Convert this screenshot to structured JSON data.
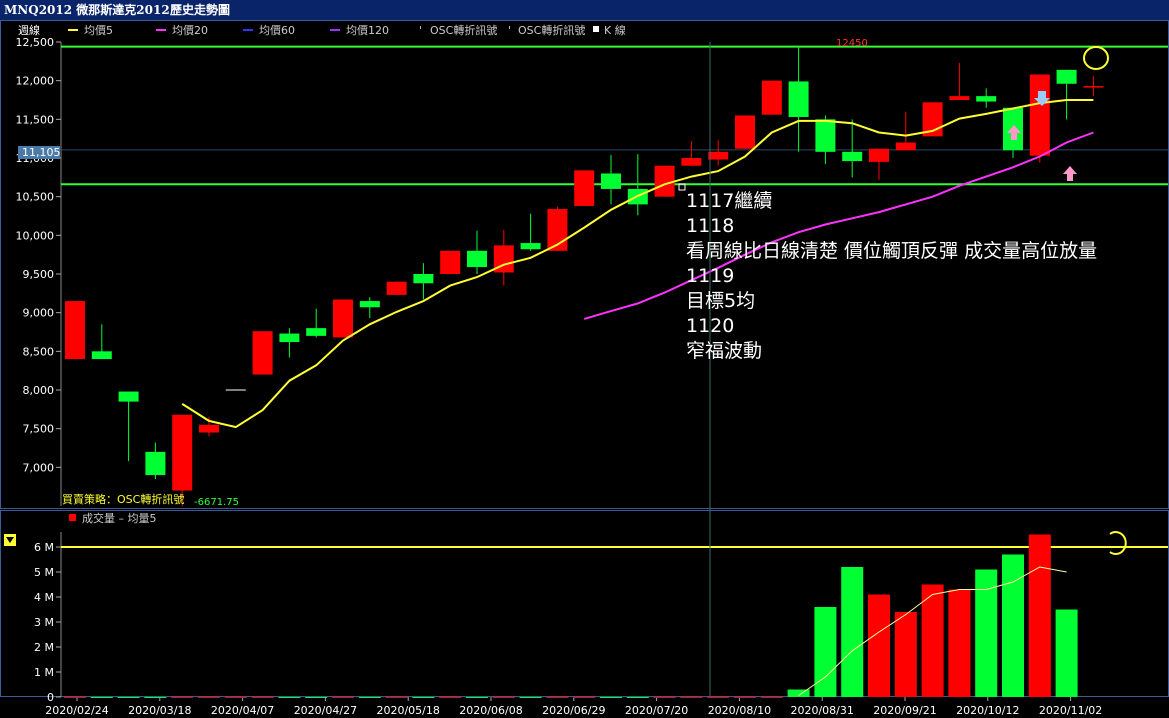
{
  "window": {
    "title": "MNQ2012 微那斯達克2012",
    "subtitle": "歷史走勢圖"
  },
  "legend": {
    "period": "週線",
    "ma5": "均價5",
    "ma20": "均價20",
    "ma60": "均價60",
    "ma120": "均價120",
    "osc1": "OSC轉折訊號",
    "osc2": "OSC轉折訊號",
    "kline": "K 線"
  },
  "strategy": {
    "label": "買賣策略：OSC轉折訊號",
    "value": "-6671.75"
  },
  "current_price_tag": "11,105",
  "max_label": "12450",
  "volume_legend": {
    "volume": "成交量",
    "ma": "均量5"
  },
  "annotation": [
    "1117繼續",
    "1118",
    "看周線比日線清楚  價位觸頂反彈 成交量高位放量",
    "1119",
    "目標5均",
    "1120",
    "窄福波動"
  ],
  "colors": {
    "up": "#ff0000",
    "down": "#00ff33",
    "ma5": "#ffff33",
    "ma20": "#ff33ff",
    "ma60": "#3333ff",
    "ma120": "#9933ff",
    "hline": "#33ff33"
  },
  "chart_data": {
    "type": "candlestick",
    "x_labels": [
      "2020/02/24",
      "2020/03/18",
      "2020/04/07",
      "2020/04/27",
      "2020/05/18",
      "2020/06/08",
      "2020/06/29",
      "2020/07/20",
      "2020/08/10",
      "2020/08/31",
      "2020/09/21",
      "2020/10/12",
      "2020/11/02"
    ],
    "y_ticks": [
      7000,
      7500,
      8000,
      8500,
      9000,
      9500,
      10000,
      10500,
      11000,
      11500,
      12000,
      12500
    ],
    "ylim": [
      6500,
      12500
    ],
    "horizontal_lines": [
      12440,
      10660,
      11105
    ],
    "candles": [
      {
        "o": 8400,
        "h": 9150,
        "l": 8400,
        "c": 9150
      },
      {
        "o": 8500,
        "h": 8850,
        "l": 8400,
        "c": 8400
      },
      {
        "o": 7980,
        "h": 7980,
        "l": 7080,
        "c": 7850
      },
      {
        "o": 7200,
        "h": 7320,
        "l": 6850,
        "c": 6900
      },
      {
        "o": 6700,
        "h": 7680,
        "l": 6500,
        "c": 7680
      },
      {
        "o": 7450,
        "h": 7650,
        "l": 7400,
        "c": 7550
      },
      {
        "o": 8000,
        "h": 8000,
        "l": 8000,
        "c": 8000
      },
      {
        "o": 8200,
        "h": 8760,
        "l": 8200,
        "c": 8760
      },
      {
        "o": 8730,
        "h": 8800,
        "l": 8420,
        "c": 8620
      },
      {
        "o": 8800,
        "h": 9050,
        "l": 8680,
        "c": 8700
      },
      {
        "o": 8680,
        "h": 9170,
        "l": 8680,
        "c": 9170
      },
      {
        "o": 9150,
        "h": 9200,
        "l": 8930,
        "c": 9070
      },
      {
        "o": 9230,
        "h": 9400,
        "l": 9230,
        "c": 9400
      },
      {
        "o": 9500,
        "h": 9640,
        "l": 9170,
        "c": 9380
      },
      {
        "o": 9500,
        "h": 9800,
        "l": 9500,
        "c": 9800
      },
      {
        "o": 9800,
        "h": 10060,
        "l": 9500,
        "c": 9590
      },
      {
        "o": 9520,
        "h": 10070,
        "l": 9350,
        "c": 9870
      },
      {
        "o": 9900,
        "h": 10280,
        "l": 9800,
        "c": 9820
      },
      {
        "o": 9800,
        "h": 10370,
        "l": 9800,
        "c": 10340
      },
      {
        "o": 10380,
        "h": 10840,
        "l": 10380,
        "c": 10840
      },
      {
        "o": 10800,
        "h": 11040,
        "l": 10400,
        "c": 10600
      },
      {
        "o": 10600,
        "h": 11050,
        "l": 10260,
        "c": 10400
      },
      {
        "o": 10500,
        "h": 10900,
        "l": 10500,
        "c": 10900
      },
      {
        "o": 10900,
        "h": 11220,
        "l": 10900,
        "c": 11000
      },
      {
        "o": 10980,
        "h": 11230,
        "l": 10900,
        "c": 11080
      },
      {
        "o": 11120,
        "h": 11550,
        "l": 11120,
        "c": 11550
      },
      {
        "o": 11560,
        "h": 12000,
        "l": 11560,
        "c": 12000
      },
      {
        "o": 11990,
        "h": 12450,
        "l": 11080,
        "c": 11530
      },
      {
        "o": 11500,
        "h": 11550,
        "l": 10920,
        "c": 11080
      },
      {
        "o": 11080,
        "h": 11500,
        "l": 10750,
        "c": 10960
      },
      {
        "o": 10950,
        "h": 11100,
        "l": 10720,
        "c": 11120
      },
      {
        "o": 11100,
        "h": 11600,
        "l": 11100,
        "c": 11200
      },
      {
        "o": 11280,
        "h": 11700,
        "l": 11280,
        "c": 11720
      },
      {
        "o": 11750,
        "h": 12230,
        "l": 11750,
        "c": 11800
      },
      {
        "o": 11800,
        "h": 11900,
        "l": 11650,
        "c": 11730
      },
      {
        "o": 11650,
        "h": 11650,
        "l": 11000,
        "c": 11100
      },
      {
        "o": 11030,
        "h": 12080,
        "l": 10940,
        "c": 12080
      },
      {
        "o": 12140,
        "h": 12140,
        "l": 11500,
        "c": 11960
      },
      {
        "o": 11930,
        "h": 12060,
        "l": 11800,
        "c": 11930
      }
    ],
    "ma5": [
      null,
      null,
      null,
      null,
      7820,
      7600,
      7520,
      7740,
      8120,
      8320,
      8640,
      8850,
      9010,
      9150,
      9350,
      9460,
      9620,
      9710,
      9880,
      10100,
      10330,
      10510,
      10660,
      10760,
      10830,
      11020,
      11330,
      11480,
      11480,
      11450,
      11330,
      11290,
      11350,
      11510,
      11570,
      11640,
      11710,
      11750,
      11750
    ],
    "ma20": [
      null,
      null,
      null,
      null,
      null,
      null,
      null,
      null,
      null,
      null,
      null,
      null,
      null,
      null,
      null,
      null,
      null,
      null,
      null,
      8920,
      9020,
      9120,
      9260,
      9420,
      9580,
      9750,
      9910,
      10040,
      10140,
      10220,
      10300,
      10400,
      10500,
      10640,
      10760,
      10880,
      11020,
      11200,
      11330
    ],
    "volume": {
      "values": [
        0,
        0,
        0,
        0,
        0,
        0,
        0,
        0,
        0,
        0,
        0,
        0,
        0,
        0,
        0,
        0,
        0,
        0,
        0,
        0,
        0,
        0,
        0,
        0,
        0,
        0,
        0,
        0.3,
        3.6,
        5.2,
        4.1,
        3.4,
        4.5,
        4.3,
        5.1,
        5.7,
        6.5,
        3.5,
        null
      ],
      "ma5": [
        null,
        null,
        null,
        null,
        null,
        null,
        null,
        null,
        null,
        null,
        null,
        null,
        null,
        null,
        null,
        null,
        null,
        null,
        null,
        null,
        null,
        null,
        null,
        null,
        null,
        null,
        null,
        0.06,
        0.8,
        1.85,
        2.6,
        3.3,
        4.1,
        4.3,
        4.3,
        4.6,
        5.2,
        5.0,
        null
      ],
      "y_ticks": [
        "0",
        "1 M",
        "2 M",
        "3 M",
        "4 M",
        "5 M",
        "6 M"
      ],
      "ylim": [
        0,
        6.6
      ],
      "hline": 6.0
    }
  }
}
